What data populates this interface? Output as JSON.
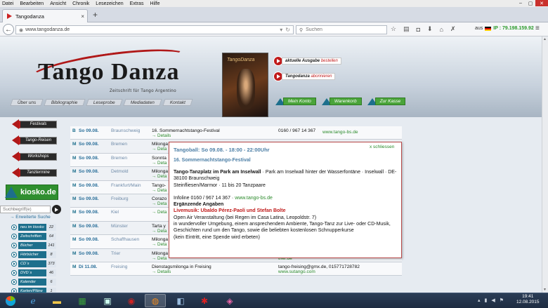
{
  "menubar": {
    "items": [
      "Datei",
      "Bearbeiten",
      "Ansicht",
      "Chronik",
      "Lesezeichen",
      "Extras",
      "Hilfe"
    ]
  },
  "window_controls": {
    "minimize": "–",
    "maximize": "▢",
    "close": "✕"
  },
  "tab": {
    "title": "Tangodanza",
    "close": "×",
    "new_tab": "+"
  },
  "navbar": {
    "url": "www.tangodanza.de",
    "search_placeholder": "Suchen",
    "ip_prefix": "aus",
    "ip": "IP : 79.198.159.92"
  },
  "site": {
    "logo_text": "Tango Danza",
    "logo_sub": "Zeitschrift für Tango Argentino",
    "magazine_title": "TangoDanza",
    "btn_issue_bold": "aktuelle Ausgabe",
    "btn_issue_em": "bestellen",
    "btn_sub_bold": "Tangodanza",
    "btn_sub_em": "abonnieren",
    "topnav": [
      "Über uns",
      "Bibliographie",
      "Leseprobe",
      "Mediadaten",
      "Kontakt"
    ],
    "greennav": [
      "Mein Konto",
      "Warenkorb",
      "Zur Kasse"
    ]
  },
  "sidebar": {
    "items": [
      "Festivals",
      "Tango-Reisen",
      "Workshops",
      "Tanztermine"
    ],
    "kiosko_text": "kiosko.de",
    "search_placeholder": "Suchbegriff(e)",
    "extended": "→ Erweiterte Suche",
    "kiosk": [
      {
        "label": "neu im kiosko",
        "count": "22"
      },
      {
        "label": "Zeitschriften",
        "count": "64"
      },
      {
        "label": "Bücher",
        "count": "141"
      },
      {
        "label": "Hörbücher",
        "count": "8"
      },
      {
        "label": "CD´s",
        "count": "373"
      },
      {
        "label": "DVD´s",
        "count": "46"
      },
      {
        "label": "Kalender",
        "count": "6"
      },
      {
        "label": "Karten/Pläne",
        "count": "1"
      }
    ]
  },
  "events": [
    {
      "type": "B",
      "date": "So 09.08.",
      "city": "Braunschweig",
      "title": "16. Sommernachtstango-Festival",
      "details": "→ Details",
      "phone": "0160 / 967 14 367",
      "web": "www.tango-bs.de"
    },
    {
      "type": "M",
      "date": "So 09.08.",
      "city": "Bremen",
      "title": "Milonga",
      "details": "→ Deta",
      "phone": "",
      "web": ""
    },
    {
      "type": "M",
      "date": "So 09.08.",
      "city": "Bremen",
      "title": "Sonnta",
      "details": "→ Deta",
      "phone": "",
      "web": ""
    },
    {
      "type": "M",
      "date": "So 09.08.",
      "city": "Detmold",
      "title": "Milonga",
      "details": "→ Deta",
      "phone": "",
      "web": ""
    },
    {
      "type": "M",
      "date": "So 09.08.",
      "city": "Frankfurt/Main",
      "title": "Tango-",
      "details": "→ Deta",
      "phone": "",
      "web": ""
    },
    {
      "type": "M",
      "date": "So 09.08.",
      "city": "Freiburg",
      "title": "Corazo",
      "details": "→ Deta",
      "phone": "",
      "web": ""
    },
    {
      "type": "M",
      "date": "So 09.08.",
      "city": "Kiel",
      "title": "",
      "details": "→ Deta",
      "phone": "",
      "web": ""
    },
    {
      "type": "M",
      "date": "So 09.08.",
      "city": "Münster",
      "title": "Tarta y",
      "details": "→ Deta",
      "phone": "",
      "web": ""
    },
    {
      "type": "M",
      "date": "So 09.08.",
      "city": "Schaffhausen",
      "title": "Milonga",
      "details": "→ Deta",
      "phone": "",
      "web": ""
    },
    {
      "type": "M",
      "date": "So 09.08.",
      "city": "Trier",
      "title": "Milonga",
      "details": "→ Deta",
      "phone": "",
      "web": "trier.de"
    },
    {
      "type": "M",
      "date": "Di 11.08.",
      "city": "Freising",
      "title": "Dienstagsmilonga in Freising",
      "details": "→ Details",
      "phone": "tango-freising@gmx.de, 015771728782",
      "web": "www.sutango.com"
    }
  ],
  "popup": {
    "title": "Tangoball: So 09.08. - 18:00 - 22:00Uhr",
    "close": "x schliessen",
    "festival": "16. Sommernachtstango-Festival",
    "venue_bold": "Tango-Tanzplatz im Park am Inselwall",
    "venue_rest": " · Park am Inselwall hinter der Wasserfontäne · Inselwall · DE-38100 Braunschweig",
    "floor": "Steinfliesen/Marmor · 11 bis 20 Tanzpaare",
    "infoline": "Infoline 0160 / 967 14 367 · ",
    "infoweb": "www.tango-bs.de",
    "extra_head": "Ergänzende Angaben",
    "live": "Livemusik: Ubaldo Pérez-Paoli und Stefan Bolte",
    "line1": "Open Air Veranstaltung (bei Regen im Casa Latina, Leopoldstr. 7)",
    "line2": "in wundervoller Umgebung, einem ansprechendem Ambiente, Tango-Tanz zur Live- oder CD-Musik,",
    "line3": "Geschichten rund um den Tango, sowie die beliebten kostenlosen Schnupperkurse",
    "line4": "(kein Eintritt, eine Spende wird erbeten)"
  },
  "taskbar": {
    "time": "19:41",
    "date": "12.08.2015"
  }
}
